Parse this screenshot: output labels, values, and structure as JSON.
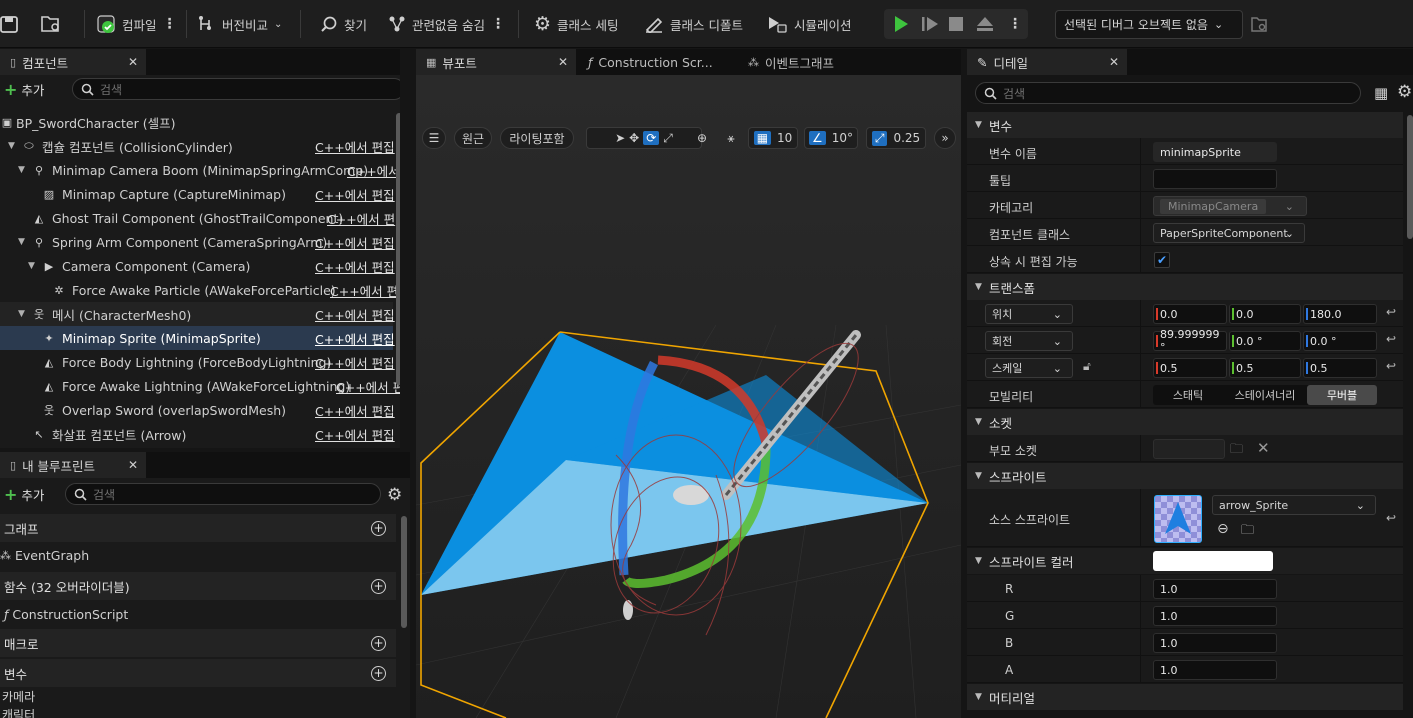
{
  "toolbar": {
    "compile": "컴파일",
    "diff": "버전비교",
    "find": "찾기",
    "hide_unrelated": "관련없음 숨김",
    "class_settings": "클래스 세팅",
    "class_defaults": "클래스 디폴트",
    "simulation": "시뮬레이션",
    "debug_object": "선택된 디버그 오브젝트 없음"
  },
  "components": {
    "tab": "컴포넌트",
    "add": "추가",
    "search_placeholder": "검색",
    "edit_cpp": "C++에서 편집",
    "edit_cpp_trunc1": "C++에서",
    "edit_cpp_trunc2": "C++에서 편",
    "edit_cpp_trunc3": "C++에서 편",
    "edit_cpp_trunc4": "C++에서 편",
    "edit_cpp_trunc5": "C++에서 편",
    "tree": [
      {
        "label": "BP_SwordCharacter (셀프)"
      },
      {
        "label": "캡슐 컴포넌트 (CollisionCylinder)"
      },
      {
        "label": "Minimap Camera Boom (MinimapSpringArmComp)"
      },
      {
        "label": "Minimap Capture (CaptureMinimap)"
      },
      {
        "label": "Ghost Trail Component (GhostTrailComponent)"
      },
      {
        "label": "Spring Arm Component (CameraSpringArm)"
      },
      {
        "label": "Camera Component (Camera)"
      },
      {
        "label": "Force Awake Particle (AWakeForceParticle)"
      },
      {
        "label": "메시 (CharacterMesh0)"
      },
      {
        "label": "Minimap Sprite (MinimapSprite)"
      },
      {
        "label": "Force Body Lightning (ForceBodyLightning)"
      },
      {
        "label": "Force Awake Lightning (AWakeForceLightning)"
      },
      {
        "label": "Overlap Sword (overlapSwordMesh)"
      },
      {
        "label": "화살표 컴포넌트 (Arrow)"
      }
    ]
  },
  "blueprint": {
    "tab": "내 블루프린트",
    "add": "추가",
    "search_placeholder": "검색",
    "graph_section": "그래프",
    "event_graph": "EventGraph",
    "functions_section": "함수 (32 오버라이더블)",
    "construction_script": "ConstructionScript",
    "macros_section": "매크로",
    "variables_section": "변수",
    "var_items": [
      "카메라",
      "캐릭터"
    ]
  },
  "viewport": {
    "tabs": [
      "뷰포트",
      "Construction Scr...",
      "이벤트그래프"
    ],
    "perspective": "원근",
    "lighting": "라이팅포함",
    "grid_snap": "10",
    "rot_snap": "10°",
    "scale_snap": "0.25"
  },
  "details": {
    "tab": "디테일",
    "search_placeholder": "검색",
    "sections": {
      "variable": "변수",
      "transform": "트랜스폼",
      "socket": "소켓",
      "sprite": "스프라이트",
      "sprite_color": "스프라이트 컬러",
      "material": "머티리얼"
    },
    "var_name_label": "변수 이름",
    "var_name": "minimapSprite",
    "tooltip_label": "툴팁",
    "category_label": "카테고리",
    "category": "MinimapCamera",
    "comp_class_label": "컴포넌트 클래스",
    "comp_class": "PaperSpriteComponent",
    "editable_label": "상속 시 편집 가능",
    "location_label": "위치",
    "location": [
      "0.0",
      "0.0",
      "180.0"
    ],
    "rotation_label": "회전",
    "rotation": [
      "89.999999 °",
      "0.0 °",
      "0.0 °"
    ],
    "scale_label": "스케일",
    "scale": [
      "0.5",
      "0.5",
      "0.5"
    ],
    "mobility_label": "모빌리티",
    "mobility": [
      "스태틱",
      "스테이셔너리",
      "무버블"
    ],
    "parent_socket_label": "부모 소켓",
    "source_sprite_label": "소스 스프라이트",
    "source_sprite": "arrow_Sprite",
    "color_channels": [
      {
        "label": "R",
        "value": "1.0"
      },
      {
        "label": "G",
        "value": "1.0"
      },
      {
        "label": "B",
        "value": "1.0"
      },
      {
        "label": "A",
        "value": "1.0"
      }
    ]
  },
  "colors": {
    "accent_blue": "#1f6fc0",
    "play_green": "#3ec43e",
    "selection_orange": "#f0a500"
  }
}
